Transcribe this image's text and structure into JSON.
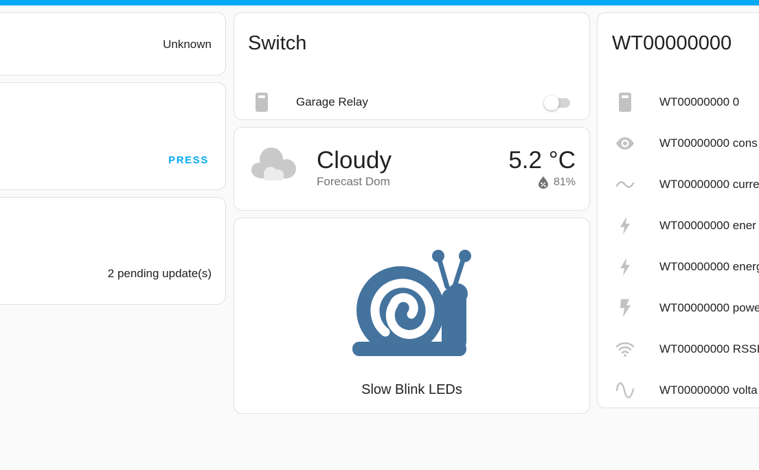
{
  "colors": {
    "accent": "#03a9f4",
    "icon_gray": "#c2c2c2",
    "snail_blue": "#44739e",
    "secondary_text": "#727272"
  },
  "left_column": {
    "state_card": {
      "value": "Unknown"
    },
    "button_card": {
      "action_label": "PRESS"
    },
    "update_card": {
      "value": "2 pending update(s)"
    }
  },
  "switch_card": {
    "title": "Switch",
    "entity": {
      "name": "Garage Relay",
      "icon": "relay-icon",
      "state": "off"
    }
  },
  "weather_card": {
    "state": "Cloudy",
    "name": "Forecast Dom",
    "temperature": "5.2",
    "temperature_unit": "°C",
    "humidity": "81%",
    "icon": "cloud-icon"
  },
  "snail_card": {
    "label": "Slow Blink LEDs",
    "icon": "snail-icon"
  },
  "device_card": {
    "title": "WT00000000",
    "entities": [
      {
        "name": "WT00000000 0",
        "icon": "relay-icon"
      },
      {
        "name": "WT00000000 cons",
        "icon": "eye-icon"
      },
      {
        "name": "WT00000000 curre",
        "icon": "current-ac-icon"
      },
      {
        "name": "WT00000000 ener",
        "icon": "lightning-icon"
      },
      {
        "name": "WT00000000 energ",
        "icon": "lightning-icon"
      },
      {
        "name": "WT00000000 powe",
        "icon": "power-flash-icon"
      },
      {
        "name": "WT00000000 RSSI",
        "icon": "wifi-icon"
      },
      {
        "name": "WT00000000 volta",
        "icon": "sine-wave-icon"
      }
    ]
  }
}
